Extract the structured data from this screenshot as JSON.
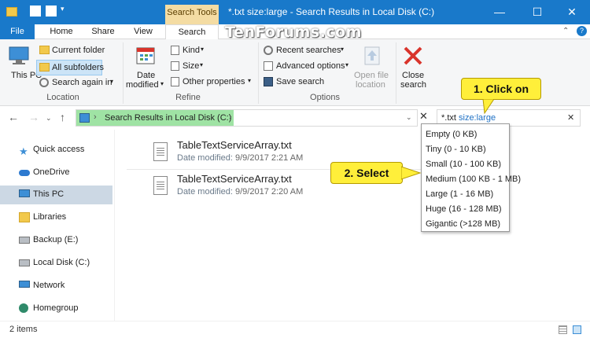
{
  "titlebar": {
    "search_tools_label": "Search Tools",
    "window_title": "*.txt size:large - Search Results in Local Disk (C:)",
    "minimize": "—",
    "maximize": "☐",
    "close": "✕"
  },
  "watermark": "TenForums.com",
  "tabs": {
    "file": "File",
    "home": "Home",
    "share": "Share",
    "view": "View",
    "search": "Search"
  },
  "ribbon": {
    "location": {
      "this_pc": "This PC",
      "current_folder": "Current folder",
      "all_subfolders": "All subfolders",
      "search_again_in": "Search again in",
      "group_label": "Location"
    },
    "refine": {
      "date_modified_1": "Date",
      "date_modified_2": "modified",
      "kind": "Kind",
      "size": "Size",
      "other_properties": "Other properties",
      "group_label": "Refine"
    },
    "options": {
      "recent_searches": "Recent searches",
      "advanced_options": "Advanced options",
      "save_search": "Save search",
      "open_file_location_1": "Open file",
      "open_file_location_2": "location",
      "group_label": "Options"
    },
    "close_search_1": "Close",
    "close_search_2": "search"
  },
  "address": {
    "path": "Search Results in Local Disk (C:)",
    "separator": "›"
  },
  "search": {
    "value_plain": "*.txt ",
    "value_keyword": "size:large",
    "clear": "✕"
  },
  "sidebar": {
    "items": [
      {
        "label": "Quick access"
      },
      {
        "label": "OneDrive"
      },
      {
        "label": "This PC"
      },
      {
        "label": "Libraries"
      },
      {
        "label": "Backup (E:)"
      },
      {
        "label": "Local Disk (C:)"
      },
      {
        "label": "Network"
      },
      {
        "label": "Homegroup"
      }
    ]
  },
  "files": [
    {
      "name": "TableTextServiceArray.txt",
      "date_label": "Date modified:",
      "date": "9/9/2017 2:21 AM"
    },
    {
      "name": "TableTextServiceArray.txt",
      "date_label": "Date modified:",
      "date": "9/9/2017 2:20 AM"
    }
  ],
  "size_options": [
    "Empty (0 KB)",
    "Tiny (0 - 10 KB)",
    "Small (10 - 100 KB)",
    "Medium (100 KB - 1 MB)",
    "Large (1 - 16 MB)",
    "Huge (16 - 128 MB)",
    "Gigantic (>128 MB)"
  ],
  "callouts": {
    "step1": "1. Click on",
    "step2": "2. Select"
  },
  "status": {
    "item_count": "2 items"
  },
  "colors": {
    "accent": "#1979ca",
    "search_tools": "#f4dca3",
    "callout": "#ffef3a",
    "address_highlight": "#9fe3a4",
    "selected_nav": "#ccd8e4"
  }
}
